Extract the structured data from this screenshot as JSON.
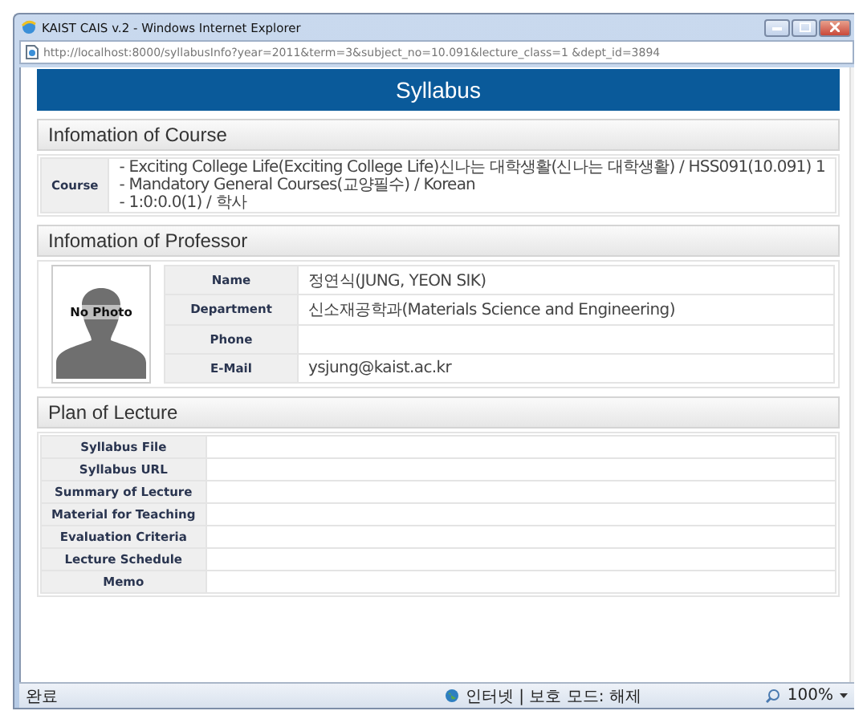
{
  "window": {
    "title": "KAIST CAIS v.2 - Windows Internet Explorer",
    "address": "http://localhost:8000/syllabusInfo?year=2011&term=3&subject_no=10.091&lecture_class=1 &dept_id=3894"
  },
  "page_title": "Syllabus",
  "course_section": {
    "heading": "Infomation of Course",
    "label": "Course",
    "lines": [
      "- Exciting College Life(Exciting College Life)신나는 대학생활(신나는 대학생활) / HSS091(10.091) 1",
      "- Mandatory General Courses(교양필수) / Korean",
      "- 1:0:0.0(1) / 학사"
    ]
  },
  "professor_section": {
    "heading": "Infomation of Professor",
    "photo_label": "No Photo",
    "rows": [
      {
        "label": "Name",
        "value": "정연식(JUNG, YEON SIK)"
      },
      {
        "label": "Department",
        "value": "신소재공학과(Materials Science and Engineering)"
      },
      {
        "label": "Phone"
      },
      {
        "label": "E-Mail",
        "value": "ysjung@kaist.ac.kr"
      }
    ]
  },
  "lecture_section": {
    "heading": "Plan of Lecture",
    "rows": [
      {
        "label": "Syllabus File"
      },
      {
        "label": "Syllabus URL"
      },
      {
        "label": "Summary of Lecture"
      },
      {
        "label": "Material for Teaching"
      },
      {
        "label": "Evaluation Criteria"
      },
      {
        "label": "Lecture Schedule"
      },
      {
        "label": "Memo"
      }
    ]
  },
  "status_bar": {
    "status": "완료",
    "zone": "인터넷 | 보호 모드: 해제",
    "zoom": "100%"
  }
}
